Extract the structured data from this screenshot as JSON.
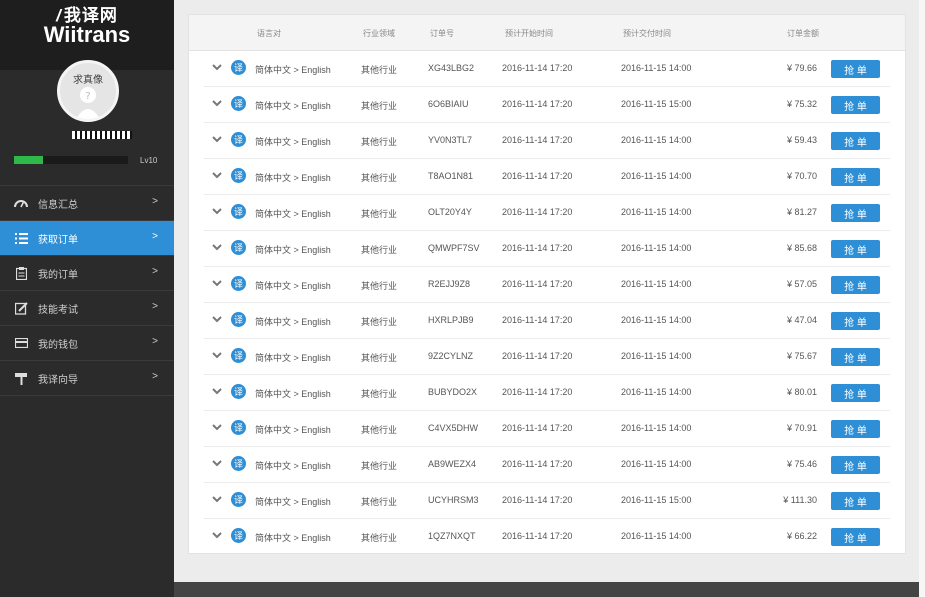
{
  "brand": {
    "cn": "我译网",
    "en": "Wiitrans"
  },
  "profile": {
    "avatar_label": "求真像",
    "progress": 0.25,
    "level": "Lv10"
  },
  "menu": [
    {
      "label": "信息汇总",
      "icon": "speedometer-icon",
      "active": false
    },
    {
      "label": "获取订单",
      "icon": "list-icon",
      "active": true
    },
    {
      "label": "我的订单",
      "icon": "clipboard-icon",
      "active": false
    },
    {
      "label": "技能考试",
      "icon": "edit-icon",
      "active": false
    },
    {
      "label": "我的钱包",
      "icon": "wallet-icon",
      "active": false
    },
    {
      "label": "我译向导",
      "icon": "signpost-icon",
      "active": false
    }
  ],
  "menu_arrow": ">",
  "table": {
    "headers": {
      "pair": "语言对",
      "field": "行业领域",
      "oid": "订单号",
      "start": "预计开始时间",
      "end": "预计交付时间",
      "amount": "订单金额"
    },
    "grab_label": "抢 单",
    "badge": "译",
    "rows": [
      {
        "pair": "简体中文 > English",
        "field": "其他行业",
        "oid": "XG43LBG2",
        "start": "2016-11-14 17:20",
        "end": "2016-11-15 14:00",
        "amount": "¥ 79.66"
      },
      {
        "pair": "简体中文 > English",
        "field": "其他行业",
        "oid": "6O6BIAIU",
        "start": "2016-11-14 17:20",
        "end": "2016-11-15 15:00",
        "amount": "¥ 75.32"
      },
      {
        "pair": "简体中文 > English",
        "field": "其他行业",
        "oid": "YV0N3TL7",
        "start": "2016-11-14 17:20",
        "end": "2016-11-15 14:00",
        "amount": "¥ 59.43"
      },
      {
        "pair": "简体中文 > English",
        "field": "其他行业",
        "oid": "T8AO1N81",
        "start": "2016-11-14 17:20",
        "end": "2016-11-15 14:00",
        "amount": "¥ 70.70"
      },
      {
        "pair": "简体中文 > English",
        "field": "其他行业",
        "oid": "OLT20Y4Y",
        "start": "2016-11-14 17:20",
        "end": "2016-11-15 14:00",
        "amount": "¥ 81.27"
      },
      {
        "pair": "简体中文 > English",
        "field": "其他行业",
        "oid": "QMWPF7SV",
        "start": "2016-11-14 17:20",
        "end": "2016-11-15 14:00",
        "amount": "¥ 85.68"
      },
      {
        "pair": "简体中文 > English",
        "field": "其他行业",
        "oid": "R2EJJ9Z8",
        "start": "2016-11-14 17:20",
        "end": "2016-11-15 14:00",
        "amount": "¥ 57.05"
      },
      {
        "pair": "简体中文 > English",
        "field": "其他行业",
        "oid": "HXRLPJB9",
        "start": "2016-11-14 17:20",
        "end": "2016-11-15 14:00",
        "amount": "¥ 47.04"
      },
      {
        "pair": "简体中文 > English",
        "field": "其他行业",
        "oid": "9Z2CYLNZ",
        "start": "2016-11-14 17:20",
        "end": "2016-11-15 14:00",
        "amount": "¥ 75.67"
      },
      {
        "pair": "简体中文 > English",
        "field": "其他行业",
        "oid": "BUBYDO2X",
        "start": "2016-11-14 17:20",
        "end": "2016-11-15 14:00",
        "amount": "¥ 80.01"
      },
      {
        "pair": "简体中文 > English",
        "field": "其他行业",
        "oid": "C4VX5DHW",
        "start": "2016-11-14 17:20",
        "end": "2016-11-15 14:00",
        "amount": "¥ 70.91"
      },
      {
        "pair": "简体中文 > English",
        "field": "其他行业",
        "oid": "AB9WEZX4",
        "start": "2016-11-14 17:20",
        "end": "2016-11-15 14:00",
        "amount": "¥ 75.46"
      },
      {
        "pair": "简体中文 > English",
        "field": "其他行业",
        "oid": "UCYHRSM3",
        "start": "2016-11-14 17:20",
        "end": "2016-11-15 15:00",
        "amount": "¥ 111.30"
      },
      {
        "pair": "简体中文 > English",
        "field": "其他行业",
        "oid": "1QZ7NXQT",
        "start": "2016-11-14 17:20",
        "end": "2016-11-15 14:00",
        "amount": "¥ 66.22"
      }
    ]
  },
  "colors": {
    "accent": "#2e8fd6",
    "sidebar": "#2b2b2b",
    "progress": "#2fb84a"
  }
}
